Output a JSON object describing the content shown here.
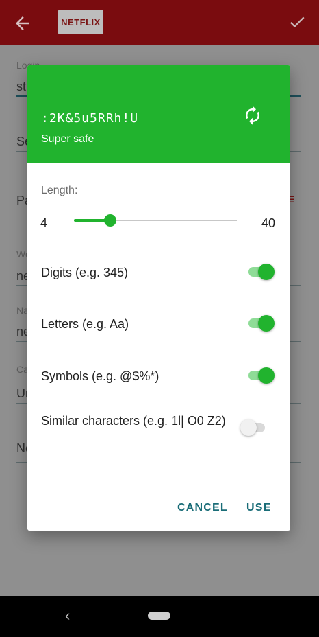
{
  "app_bar": {
    "back_icon": "arrow-left-icon",
    "logo_text": "NETFLIX",
    "confirm_icon": "check-icon",
    "color": "#7a0c0f"
  },
  "form": {
    "login_label": "Login",
    "login_value": "st",
    "secret_label": "Se",
    "password_label": "Pa",
    "password_action_hint": "E",
    "website_label": "We",
    "website_value": "ne",
    "name_label": "Na",
    "name_value": "ne",
    "category_label": "Ca",
    "category_value": "Ur",
    "notes_label": "No"
  },
  "dialog": {
    "header_color": "#21b32e",
    "generated_password": ":2K&5u5RRh!U",
    "strength_label": "Super safe",
    "refresh_icon": "refresh-icon",
    "length_label": "Length:",
    "length_min": "4",
    "length_max": "40",
    "length_value": 12,
    "options": [
      {
        "label": "Digits (e.g. 345)",
        "enabled": true
      },
      {
        "label": "Letters (e.g. Aa)",
        "enabled": true
      },
      {
        "label": "Symbols (e.g. @$%*)",
        "enabled": true
      },
      {
        "label": "Similar characters (e.g. 1l| O0 Z2)",
        "enabled": false
      }
    ],
    "cancel_label": "CANCEL",
    "use_label": "USE"
  },
  "nav_bar": {
    "back_icon": "nav-back-icon",
    "home_icon": "nav-home-icon"
  }
}
